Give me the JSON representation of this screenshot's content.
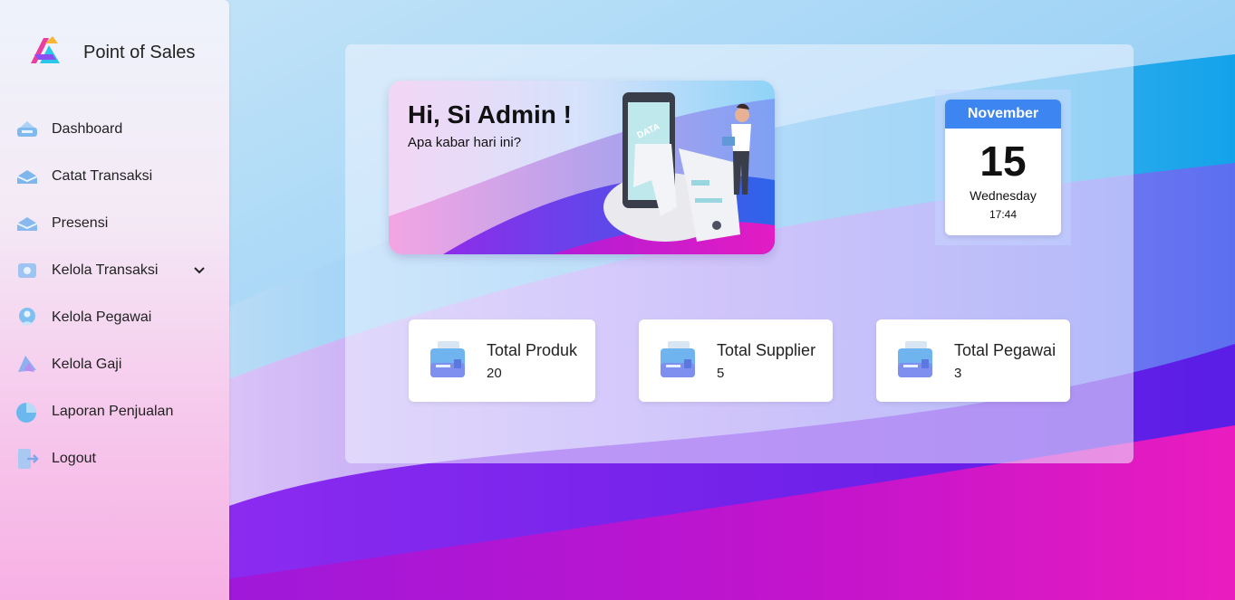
{
  "app": {
    "name": "Point of Sales"
  },
  "sidebar": {
    "items": [
      {
        "label": "Dashboard",
        "icon": "dashboard-icon"
      },
      {
        "label": "Catat Transaksi",
        "icon": "transaction-icon"
      },
      {
        "label": "Presensi",
        "icon": "attendance-icon"
      },
      {
        "label": "Kelola Transaksi",
        "icon": "manage-transaction-icon",
        "expandable": true
      },
      {
        "label": "Kelola Pegawai",
        "icon": "employee-icon"
      },
      {
        "label": "Kelola Gaji",
        "icon": "salary-icon"
      },
      {
        "label": "Laporan Penjualan",
        "icon": "sales-report-icon"
      },
      {
        "label": "Logout",
        "icon": "logout-icon"
      }
    ]
  },
  "welcome": {
    "title": "Hi, Si Admin !",
    "subtitle": "Apa kabar hari ini?",
    "illustration_text": "DATA"
  },
  "calendar": {
    "month": "November",
    "day": "15",
    "weekday": "Wednesday",
    "time": "17:44"
  },
  "stats": [
    {
      "label": "Total Produk",
      "value": "20",
      "icon": "product-box-icon"
    },
    {
      "label": "Total Supplier",
      "value": "5",
      "icon": "supplier-box-icon"
    },
    {
      "label": "Total Pegawai",
      "value": "3",
      "icon": "employee-box-icon"
    }
  ],
  "colors": {
    "accent": "#3d86f2",
    "wallpaper_violet": "#7a2df0",
    "wallpaper_magenta": "#e21cc3"
  }
}
